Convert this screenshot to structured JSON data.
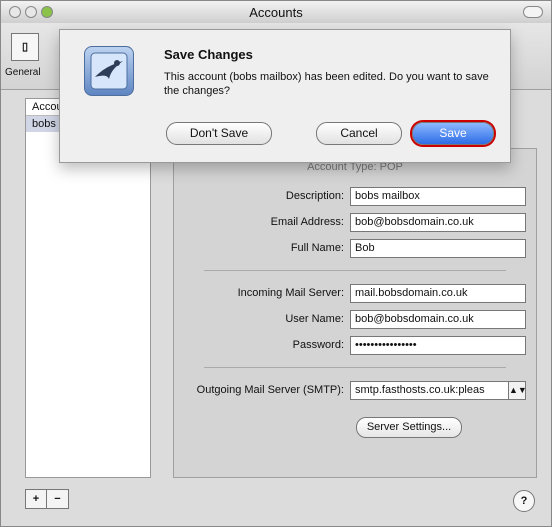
{
  "window": {
    "title": "Accounts"
  },
  "toolbar": {
    "general_label": "General",
    "general_icon": "iphone-icon"
  },
  "accounts": {
    "header": "Accounts",
    "selected": "bobs mailbox"
  },
  "dialog": {
    "title": "Save Changes",
    "message": "This account (bobs mailbox) has been edited.  Do you want to save the changes?",
    "buttons": {
      "dont_save": "Don't Save",
      "cancel": "Cancel",
      "save": "Save"
    }
  },
  "form": {
    "account_type": "Account Type: POP",
    "description": {
      "label": "Description:",
      "value": "bobs mailbox"
    },
    "email": {
      "label": "Email Address:",
      "value": "bob@bobsdomain.co.uk"
    },
    "full_name": {
      "label": "Full Name:",
      "value": "Bob"
    },
    "incoming": {
      "label": "Incoming Mail Server:",
      "value": "mail.bobsdomain.co.uk"
    },
    "user_name": {
      "label": "User Name:",
      "value": "bob@bobsdomain.co.uk"
    },
    "password": {
      "label": "Password:",
      "value": "••••••••••••••••"
    },
    "smtp": {
      "label": "Outgoing Mail Server (SMTP):",
      "value": "smtp.fasthosts.co.uk:pleas"
    },
    "server_settings": "Server Settings..."
  },
  "bottom": {
    "plus": "+",
    "minus": "−",
    "help": "?"
  }
}
